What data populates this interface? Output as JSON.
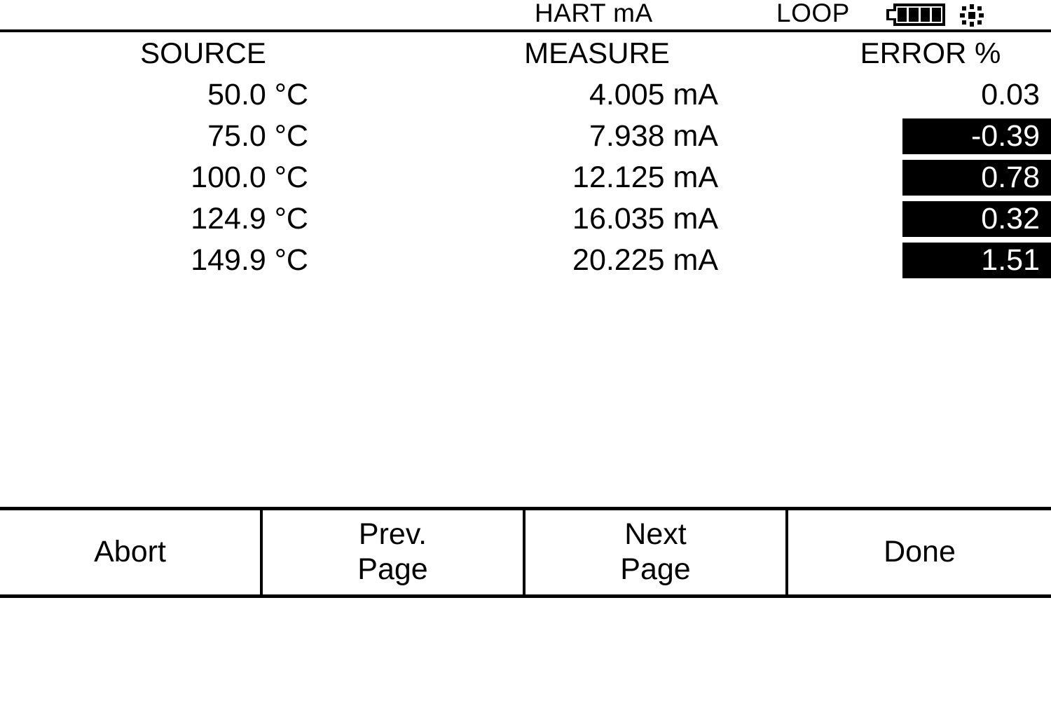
{
  "status_bar": {
    "mode": "HART mA",
    "loop": "LOOP",
    "battery_icon": "battery-icon",
    "battery_bars": 4,
    "backlight_icon": "sun-backlight-icon"
  },
  "table": {
    "headers": {
      "source": "SOURCE",
      "measure": "MEASURE",
      "error": "ERROR %"
    },
    "rows": [
      {
        "source": "50.0 °C",
        "measure": "4.005 mA",
        "error": "0.03",
        "highlighted": false
      },
      {
        "source": "75.0 °C",
        "measure": "7.938 mA",
        "error": "-0.39",
        "highlighted": true
      },
      {
        "source": "100.0 °C",
        "measure": "12.125 mA",
        "error": "0.78",
        "highlighted": true
      },
      {
        "source": "124.9 °C",
        "measure": "16.035 mA",
        "error": "0.32",
        "highlighted": true
      },
      {
        "source": "149.9 °C",
        "measure": "20.225 mA",
        "error": "1.51",
        "highlighted": true
      }
    ]
  },
  "softkeys": [
    {
      "label": "Abort"
    },
    {
      "label": "Prev.\nPage"
    },
    {
      "label": "Next\nPage"
    },
    {
      "label": "Done"
    }
  ],
  "colors": {
    "foreground": "#000000",
    "background": "#ffffff",
    "highlight_bg": "#000000",
    "highlight_fg": "#ffffff"
  }
}
